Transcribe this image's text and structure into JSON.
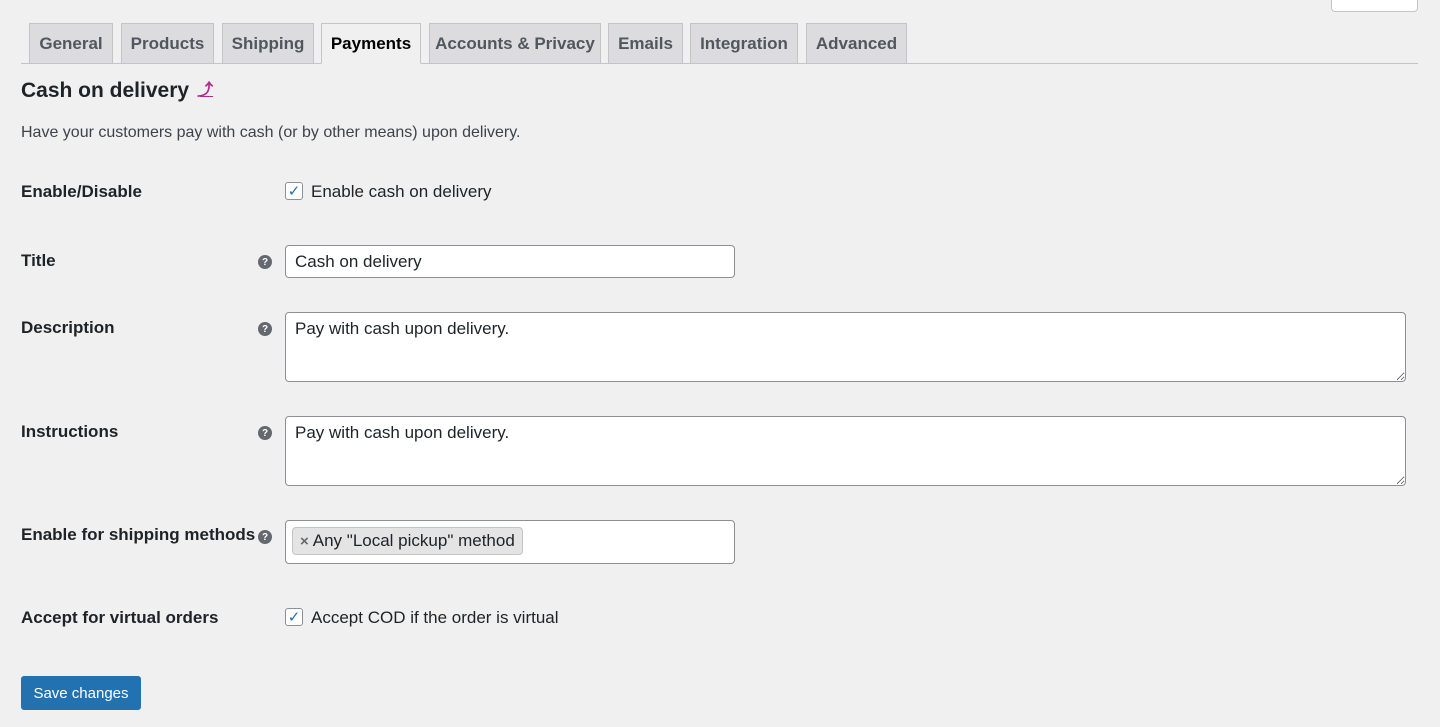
{
  "tabs": [
    {
      "label": "General"
    },
    {
      "label": "Products"
    },
    {
      "label": "Shipping"
    },
    {
      "label": "Payments"
    },
    {
      "label": "Accounts & Privacy"
    },
    {
      "label": "Emails"
    },
    {
      "label": "Integration"
    },
    {
      "label": "Advanced"
    }
  ],
  "active_tab": "Payments",
  "heading": {
    "title": "Cash on delivery",
    "up_link": "⤴"
  },
  "description": "Have your customers pay with cash (or by other means) upon delivery.",
  "fields": {
    "enable": {
      "label": "Enable/Disable",
      "checkbox_label": "Enable cash on delivery",
      "checked": true
    },
    "title": {
      "label": "Title",
      "value": "Cash on delivery"
    },
    "description": {
      "label": "Description",
      "value": "Pay with cash upon delivery."
    },
    "instructions": {
      "label": "Instructions",
      "value": "Pay with cash upon delivery."
    },
    "shipping_methods": {
      "label": "Enable for shipping methods",
      "selected": "Any \"Local pickup\" method",
      "remove": "×"
    },
    "virtual": {
      "label": "Accept for virtual orders",
      "checkbox_label": "Accept COD if the order is virtual",
      "checked": true
    }
  },
  "tip_glyph": "?",
  "check_glyph": "✓",
  "save_label": "Save changes",
  "colors": {
    "primary": "#2271b1",
    "link": "#b32d8c",
    "background": "#f0f0f1"
  }
}
